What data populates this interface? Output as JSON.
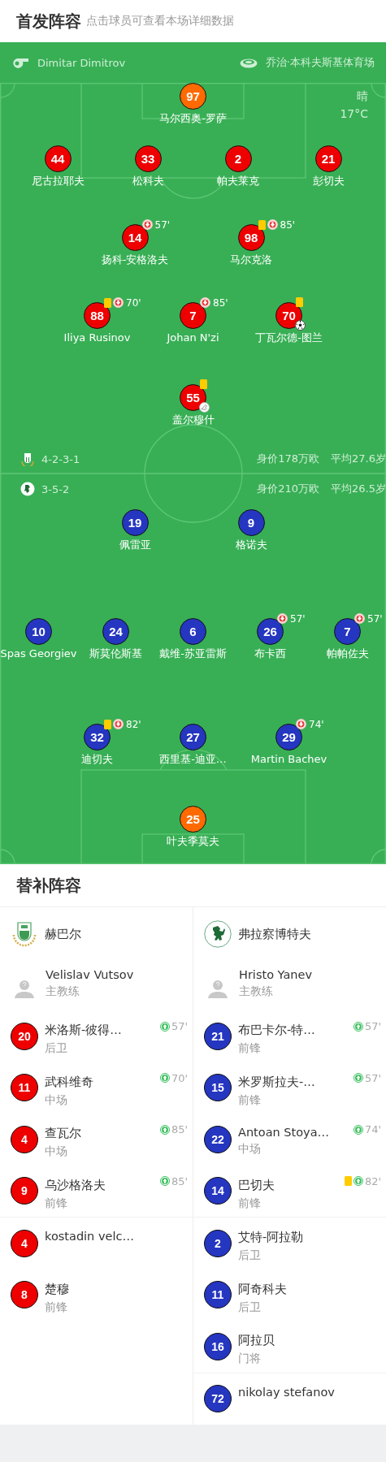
{
  "header": {
    "title": "首发阵容",
    "hint": "点击球员可查看本场详细数据"
  },
  "pitch": {
    "referee": "Dimitar Dimitrov",
    "stadium": "乔治·本科夫斯基体育场",
    "weather": "晴",
    "temperature": "17°C",
    "home": {
      "formation": "4-2-3-1",
      "value": "身价178万欧",
      "age": "平均27.6岁",
      "lines": [
        [
          {
            "number": "97",
            "name": "马尔西奥-罗萨",
            "color": "#ff6a00",
            "yellow_card": false
          }
        ],
        [
          {
            "number": "44",
            "name": "尼古拉耶夫",
            "color": "#ee0000",
            "yellow_card": false
          },
          {
            "number": "33",
            "name": "松科夫",
            "color": "#ee0000",
            "yellow_card": false
          },
          {
            "number": "2",
            "name": "帕夫莱克",
            "color": "#ee0000",
            "yellow_card": false
          },
          {
            "number": "21",
            "name": "彭切夫",
            "color": "#ee0000",
            "yellow_card": false
          }
        ],
        [
          {
            "number": "14",
            "name": "扬科-安格洛夫",
            "color": "#ee0000",
            "yellow_card": false,
            "sub_out": "57'"
          },
          {
            "number": "98",
            "name": "马尔克洛",
            "color": "#ee0000",
            "yellow_card": true,
            "sub_out": "85'"
          }
        ],
        [
          {
            "number": "88",
            "name": "Iliya Rusinov",
            "color": "#ee0000",
            "yellow_card": true,
            "sub_out": "70'"
          },
          {
            "number": "7",
            "name": "Johan N'zi",
            "color": "#ee0000",
            "yellow_card": false,
            "sub_out": "85'"
          },
          {
            "number": "70",
            "name": "丁瓦尔德-图兰",
            "color": "#ee0000",
            "yellow_card": true,
            "bottom_icon": {
              "kind": "ball"
            }
          }
        ],
        [
          {
            "number": "55",
            "name": "盖尔穆什",
            "color": "#ee0000",
            "yellow_card": true,
            "bottom_icon": {
              "kind": "boot"
            }
          }
        ]
      ]
    },
    "away": {
      "formation": "3-5-2",
      "value": "身价210万欧",
      "age": "平均26.5岁",
      "lines": [
        [
          {
            "number": "19",
            "name": "佩雷亚",
            "color": "#2536c0",
            "yellow_card": false
          },
          {
            "number": "9",
            "name": "格诺夫",
            "color": "#2536c0",
            "yellow_card": false
          }
        ],
        [
          {
            "number": "10",
            "name": "Spas Georgiev",
            "color": "#2536c0",
            "yellow_card": false
          },
          {
            "number": "24",
            "name": "斯莫伦斯基",
            "color": "#2536c0",
            "yellow_card": false
          },
          {
            "number": "6",
            "name": "戴维-苏亚雷斯",
            "color": "#2536c0",
            "yellow_card": false
          },
          {
            "number": "26",
            "name": "布卡西",
            "color": "#2536c0",
            "yellow_card": false,
            "sub_out": "57'"
          },
          {
            "number": "7",
            "name": "帕帕佐夫",
            "color": "#2536c0",
            "yellow_card": false,
            "sub_out": "57'"
          }
        ],
        [
          {
            "number": "32",
            "name": "迪切夫",
            "color": "#2536c0",
            "yellow_card": true,
            "sub_out": "82'"
          },
          {
            "number": "27",
            "name": "西里基-迪亚…",
            "color": "#2536c0",
            "yellow_card": false
          },
          {
            "number": "29",
            "name": "Martin Bachev",
            "color": "#2536c0",
            "yellow_card": false,
            "sub_out": "74'"
          }
        ],
        [
          {
            "number": "25",
            "name": "叶夫季莫夫",
            "color": "#ff6a00",
            "yellow_card": false
          }
        ]
      ]
    }
  },
  "subs": {
    "title": "替补阵容",
    "teams": [
      {
        "name": "赫巴尔",
        "kind": "shield",
        "color": "#ee0000",
        "coach": {
          "name": "Velislav Vutsov",
          "role": "主教练"
        },
        "groups": [
          [
            {
              "number": "20",
              "name": "米洛斯-彼得…",
              "position": "后卫",
              "sub_in": "57'",
              "yellow_card": false
            },
            {
              "number": "11",
              "name": "武科维奇",
              "position": "中场",
              "sub_in": "70'",
              "yellow_card": false
            },
            {
              "number": "4",
              "name": "查瓦尔",
              "position": "中场",
              "sub_in": "85'",
              "yellow_card": false
            },
            {
              "number": "9",
              "name": "乌沙格洛夫",
              "position": "前锋",
              "sub_in": "85'",
              "yellow_card": false
            }
          ],
          [
            {
              "number": "4",
              "name": "kostadin velc…",
              "yellow_card": false
            },
            {
              "number": "8",
              "name": "楚穆",
              "position": "前锋",
              "yellow_card": false
            }
          ]
        ]
      },
      {
        "name": "弗拉察博特夫",
        "kind": "lion",
        "color": "#2536c0",
        "coach": {
          "name": "Hristo Yanev",
          "role": "主教练"
        },
        "groups": [
          [
            {
              "number": "21",
              "name": "布巴卡尔-特…",
              "position": "前锋",
              "sub_in": "57'",
              "yellow_card": false
            },
            {
              "number": "15",
              "name": "米罗斯拉夫-…",
              "position": "前锋",
              "sub_in": "57'",
              "yellow_card": false
            },
            {
              "number": "22",
              "name": "Antoan Stoya…",
              "position": "中场",
              "sub_in": "74'",
              "yellow_card": false
            },
            {
              "number": "14",
              "name": "巴切夫",
              "position": "前锋",
              "sub_in": "82'",
              "yellow_card": true
            }
          ],
          [
            {
              "number": "2",
              "name": "艾特-阿拉勒",
              "position": "后卫",
              "yellow_card": false
            },
            {
              "number": "11",
              "name": "阿奇科夫",
              "position": "后卫",
              "yellow_card": false
            },
            {
              "number": "16",
              "name": "阿拉贝",
              "position": "门将",
              "yellow_card": false
            }
          ],
          [
            {
              "number": "72",
              "name": "nikolay stefanov",
              "yellow_card": false
            }
          ]
        ]
      }
    ]
  }
}
